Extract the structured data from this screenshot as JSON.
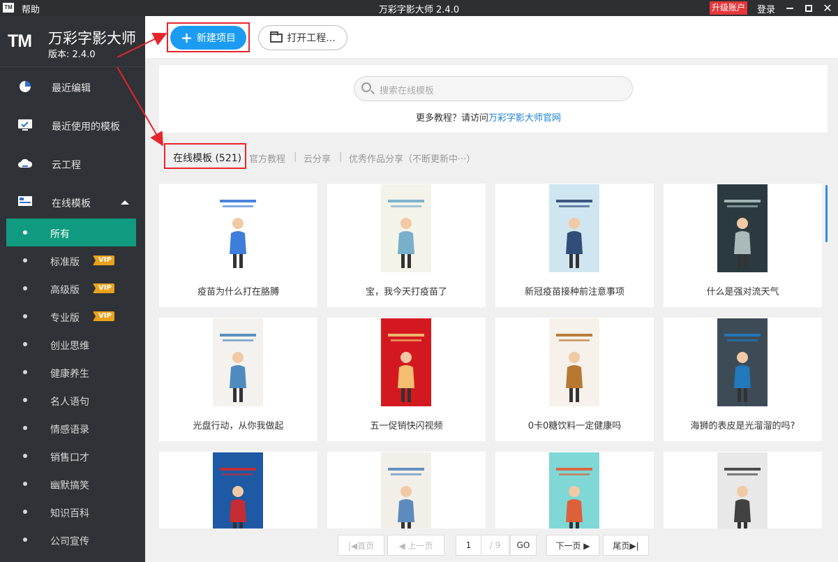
{
  "titlebar": {
    "logo": "TM",
    "help": "帮助",
    "title": "万彩字影大师 2.4.0",
    "upgrade": "升级账户",
    "login": "登录"
  },
  "brand": {
    "logo": "TM",
    "name": "万彩字影大师",
    "version": "版本: 2.4.0"
  },
  "sidebar": {
    "recent_edit": "最近编辑",
    "recent_templates": "最近使用的模板",
    "cloud": "云工程",
    "online": "在线模板",
    "categories": [
      {
        "label": "所有",
        "vip": false
      },
      {
        "label": "标准版",
        "vip": true
      },
      {
        "label": "高级版",
        "vip": true
      },
      {
        "label": "专业版",
        "vip": true
      },
      {
        "label": "创业思维",
        "vip": false
      },
      {
        "label": "健康养生",
        "vip": false
      },
      {
        "label": "名人语句",
        "vip": false
      },
      {
        "label": "情感语录",
        "vip": false
      },
      {
        "label": "销售口才",
        "vip": false
      },
      {
        "label": "幽默搞笑",
        "vip": false
      },
      {
        "label": "知识百科",
        "vip": false
      },
      {
        "label": "公司宣传",
        "vip": false
      }
    ],
    "vip_label": "VIP"
  },
  "toolbar": {
    "new_project": "新建项目",
    "open_project": "打开工程..."
  },
  "search": {
    "placeholder": "搜索在线模板",
    "tutorial_prefix": "更多教程？请访问",
    "tutorial_link": "万彩字影大师官网"
  },
  "tabs": {
    "active": "在线模板 (521)",
    "official": "官方教程",
    "cloud_share": "云分享",
    "showcase": "优秀作品分享（不断更新中···）",
    "separator": "|"
  },
  "templates": [
    {
      "title": "疫苗为什么打在胳膊",
      "bg": "#ffffff",
      "accent": "#2a6fd6"
    },
    {
      "title": "宝，我今天打疫苗了",
      "bg": "#f3f3ea",
      "accent": "#6aa7c8"
    },
    {
      "title": "新冠疫苗接种前注意事项",
      "bg": "#cfe6f1",
      "accent": "#1e3d6b"
    },
    {
      "title": "什么是强对流天气",
      "bg": "#2a3a3f",
      "accent": "#b7c9c9"
    },
    {
      "title": "光盘行动，从你我做起",
      "bg": "#f4f2ee",
      "accent": "#3d7fb8"
    },
    {
      "title": "五一促销快闪视频",
      "bg": "#d3191f",
      "accent": "#f7d27a"
    },
    {
      "title": "0卡0糖饮料一定健康吗",
      "bg": "#f6f1ea",
      "accent": "#b06a1d"
    },
    {
      "title": "海狮的表皮是光溜溜的吗?",
      "bg": "#3d4b57",
      "accent": "#1f7ec7"
    },
    {
      "title": "",
      "bg": "#1d5aa3",
      "accent": "#d82828"
    },
    {
      "title": "",
      "bg": "#f2efe9",
      "accent": "#4d7fb8"
    },
    {
      "title": "",
      "bg": "#7fd8d6",
      "accent": "#e8532a"
    },
    {
      "title": "",
      "bg": "#e8e8e8",
      "accent": "#2f2f2f"
    }
  ],
  "pagination": {
    "first": "|◀首页",
    "prev": "◀ 上一页",
    "current": "1",
    "total": "/ 9",
    "go": "GO",
    "next": "下一页 ▶",
    "last": "尾页▶|"
  },
  "colors": {
    "sidebar_bg": "#2f3236",
    "active_category": "#109a7f",
    "primary_button": "#1b9cf2",
    "highlight_box": "#e8252b",
    "vip_badge": "#e8a21c"
  }
}
